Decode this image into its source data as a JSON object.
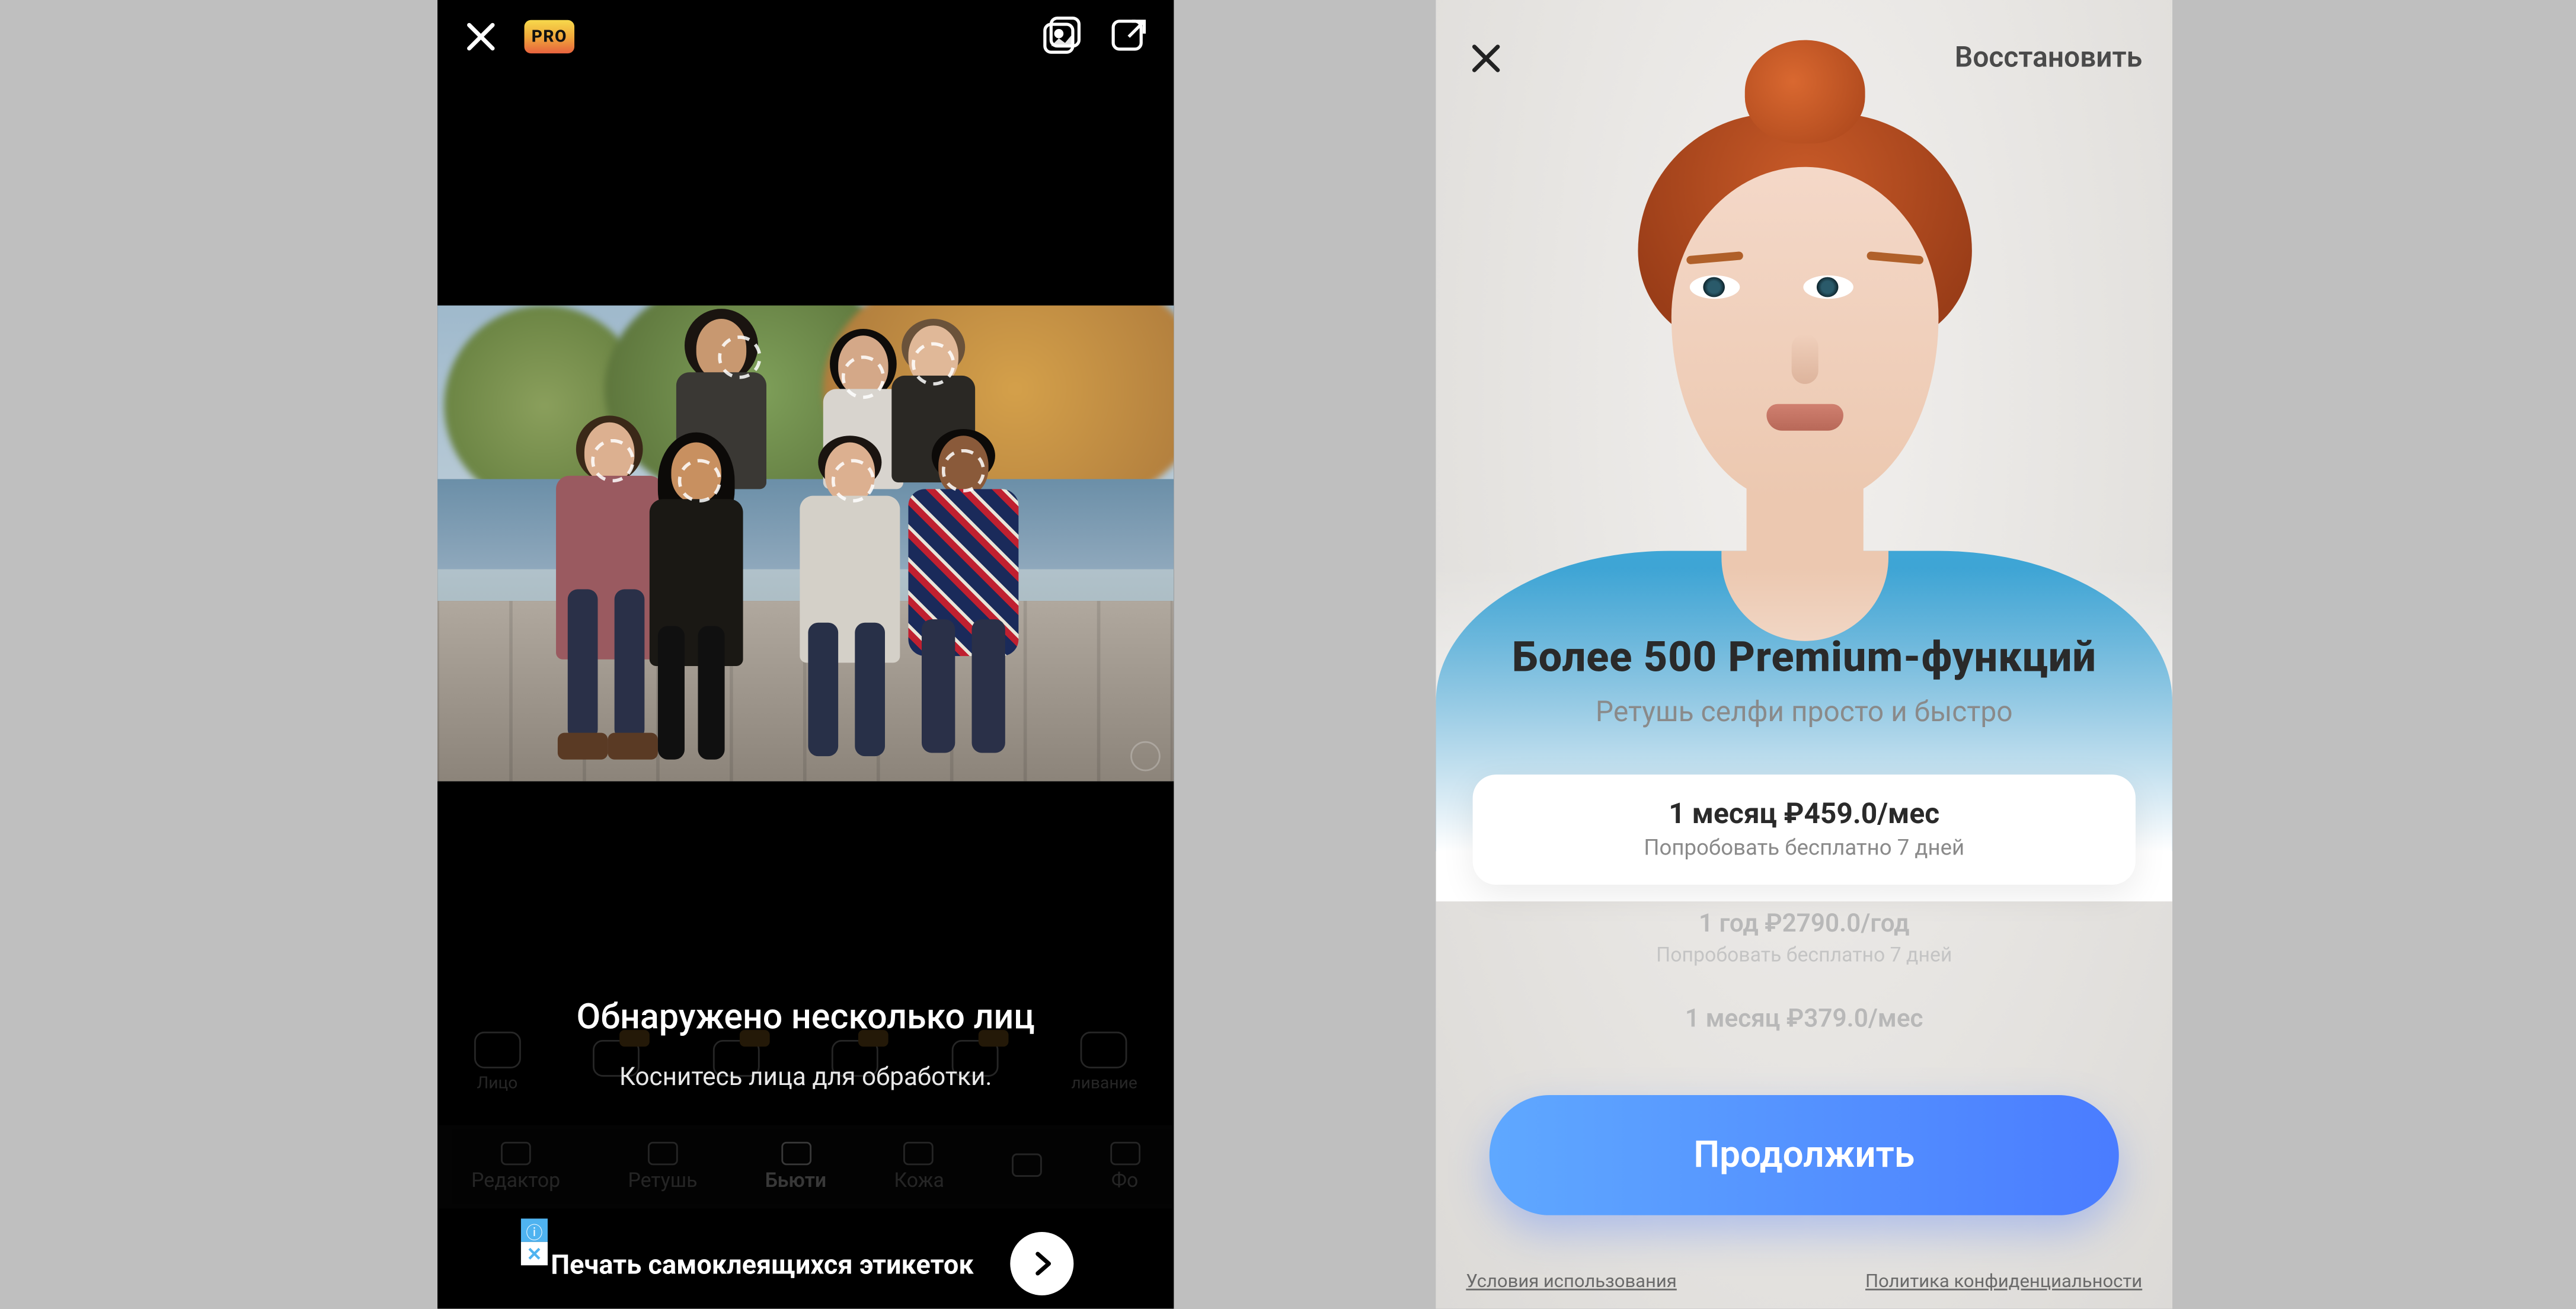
{
  "left": {
    "pro_badge": "PRO",
    "overlay": {
      "title": "Обнаружено несколько лиц",
      "subtitle": "Коснитесь лица для обработки."
    },
    "tools": [
      {
        "label": "Лицо",
        "pro": false
      },
      {
        "label": "",
        "pro": true
      },
      {
        "label": "",
        "pro": true
      },
      {
        "label": "",
        "pro": true
      },
      {
        "label": "",
        "pro": true
      },
      {
        "label": "ливание",
        "pro": false
      }
    ],
    "tabs": [
      {
        "label": "Редактор",
        "active": false
      },
      {
        "label": "Ретушь",
        "active": false
      },
      {
        "label": "Бьюти",
        "active": true
      },
      {
        "label": "Кожа",
        "active": false
      },
      {
        "label": "",
        "active": false
      },
      {
        "label": "Фо",
        "active": false
      }
    ],
    "ad": {
      "text": "Печать самоклеящихся этикеток",
      "info_symbol": "ⓘ",
      "close_symbol": "✕"
    }
  },
  "right": {
    "restore": "Восстановить",
    "headline": "Более 500  Premium-функций",
    "subheadline": "Ретушь селфи просто и быстро",
    "plans": [
      {
        "title": "1 месяц ₽459.0/мес",
        "subtitle": "Попробовать бесплатно 7 дней",
        "selected": true
      },
      {
        "title": "1 год ₽2790.0/год",
        "subtitle": "Попробовать бесплатно 7 дней",
        "selected": false
      },
      {
        "title": "1 месяц ₽379.0/мес",
        "subtitle": "",
        "selected": false
      }
    ],
    "cta": "Продолжить",
    "legal": {
      "terms": "Условия использования",
      "privacy": "Политика конфиденциальности"
    }
  }
}
